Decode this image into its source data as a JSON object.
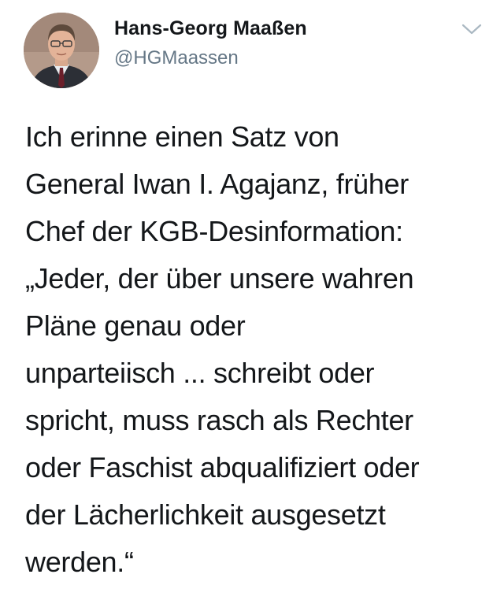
{
  "tweet": {
    "author": {
      "display_name": "Hans-Georg Maaßen",
      "handle": "@HGMaassen",
      "avatar_icon": "profile-photo",
      "menu_icon": "chevron-down-icon"
    },
    "text_lines": [
      "Ich erinne einen Satz von",
      "General Iwan I. Agajanz, früher",
      "Chef der KGB-Desinformation:",
      "„Jeder, der über unsere wahren",
      "Pläne genau oder",
      "unparteiisch ... schreibt oder",
      "spricht, muss rasch als Rechter",
      "oder Faschist abqualifiziert oder",
      "der Lächerlichkeit ausgesetzt",
      "werden.“"
    ]
  },
  "colors": {
    "text_primary": "#14171a",
    "text_secondary": "#657786",
    "caret": "#aab8c2",
    "background": "#ffffff"
  }
}
